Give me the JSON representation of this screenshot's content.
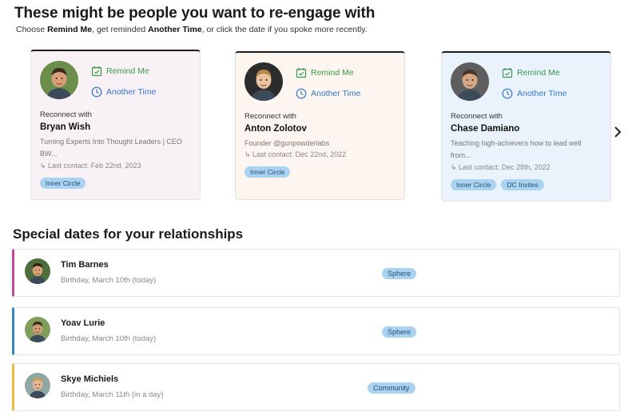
{
  "header": {
    "title": "These might be people you want to re-engage with",
    "subtitle_parts": [
      "Choose ",
      "Remind Me",
      ", get reminded ",
      "Another Time",
      ", or click the date if you spoke more recently."
    ]
  },
  "reengage": {
    "remind_label": "Remind Me",
    "another_label": "Another Time",
    "reconnect_label": "Reconnect with",
    "cards": [
      {
        "name": "Bryan Wish",
        "description": "Turning Experts Into Thought Leaders | CEO BW...",
        "last_contact": "Last contact: Feb 22nd, 2023",
        "tags": [
          "Inner Circle"
        ],
        "background": "#f8f1f6",
        "avatar_bg": "#6b8f4a",
        "avatar_skin": "#d8a07a",
        "avatar_hair": "#3a2a1f"
      },
      {
        "name": "Anton Zolotov",
        "description": "Founder @gunpowderlabs",
        "last_contact": "Last contact: Dec 22nd, 2022",
        "tags": [
          "Inner Circle"
        ],
        "background": "#fdf6f0",
        "avatar_bg": "#2c2c2c",
        "avatar_skin": "#e9c2a0",
        "avatar_hair": "#b58a4a"
      },
      {
        "name": "Chase Damiano",
        "description": "Teaching high-achievers how to lead well from...",
        "last_contact": "Last contact: Dec 28th, 2022",
        "tags": [
          "Inner Circle",
          "DC Invites"
        ],
        "background": "#eaf3fb",
        "avatar_bg": "#5e5e5e",
        "avatar_skin": "#d4a884",
        "avatar_hair": "#4a3526"
      }
    ],
    "next_icon": "chevron-right-icon"
  },
  "special_dates": {
    "title": "Special dates for your relationships",
    "rows": [
      {
        "name": "Tim Barnes",
        "date": "Birthday, March 10th (today)",
        "tag": "Sphere",
        "accent": "#c2499d",
        "avatar_bg": "#4d6e3a",
        "avatar_skin": "#d9a27c",
        "avatar_hair": "#2e2119"
      },
      {
        "name": "Yoav Lurie",
        "date": "Birthday, March 10th (today)",
        "tag": "Sphere",
        "accent": "#2f86c4",
        "avatar_bg": "#7f9e5c",
        "avatar_skin": "#cf9c78",
        "avatar_hair": "#3b2a1e"
      },
      {
        "name": "Skye Michiels",
        "date": "Birthday, March 11th (in a day)",
        "tag": "Community",
        "accent": "#efb93a",
        "avatar_bg": "#8fa6a3",
        "avatar_skin": "#e2b697",
        "avatar_hair": "#c9a15e"
      }
    ]
  }
}
